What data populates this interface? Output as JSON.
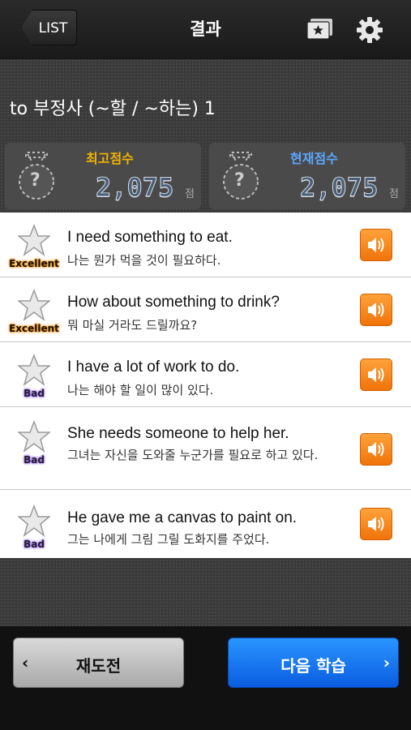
{
  "nav": {
    "back_label": "LIST",
    "title": "결과",
    "icons": [
      "star-folder-icon",
      "gear-icon"
    ]
  },
  "lesson": {
    "title": "to 부정사 (~할 / ~하는) 1"
  },
  "scores": {
    "best": {
      "label": "최고점수",
      "value": "2,075",
      "unit": "점",
      "medal": "?"
    },
    "current": {
      "label": "현재점수",
      "value": "2,075",
      "unit": "점",
      "medal": "?"
    }
  },
  "sentences": [
    {
      "grade": "Excellent",
      "en": "I need something to eat.",
      "ko": "나는 뭔가 먹을 것이 필요하다."
    },
    {
      "grade": "Excellent",
      "en": "How about something to drink?",
      "ko": "뭐 마실 거라도 드릴까요?"
    },
    {
      "grade": "Bad",
      "en": "I have a lot of work to do.",
      "ko": "나는 해야 할 일이 많이 있다."
    },
    {
      "grade": "Bad",
      "en": "She needs someone to help her.",
      "ko": "그녀는 자신을 도와줄 누군가를 필요로 하고 있다."
    },
    {
      "grade": "Bad",
      "en": "He gave me a canvas to paint on.",
      "ko": "그는 나에게 그림 그릴 도화지를 주었다."
    }
  ],
  "footer": {
    "retry_label": "재도전",
    "retry_chevron": "‹",
    "next_label": "다음 학습",
    "next_chevron": "›"
  },
  "colors": {
    "best_label": "#f2b400",
    "current_label": "#5aa8ff",
    "next_button": "#1a7af0",
    "sound_button": "#f5861a"
  }
}
